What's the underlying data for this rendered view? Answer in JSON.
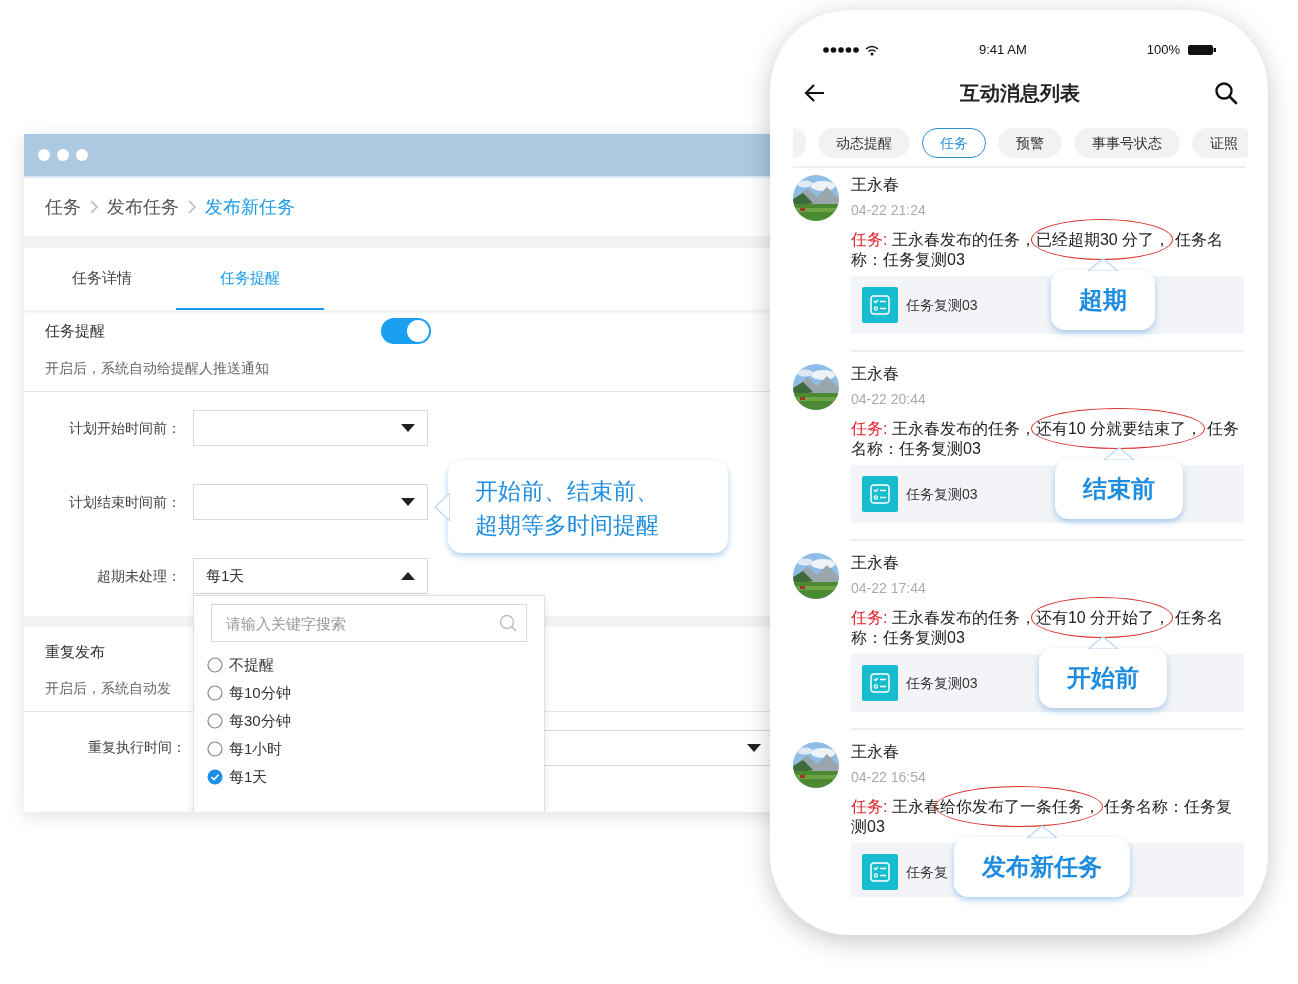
{
  "desktop": {
    "breadcrumb": [
      {
        "label": "任务",
        "current": false
      },
      {
        "label": "发布任务",
        "current": false
      },
      {
        "label": "发布新任务",
        "current": true
      }
    ],
    "tabs": [
      {
        "label": "任务详情",
        "selected": false
      },
      {
        "label": "任务提醒",
        "selected": true
      }
    ],
    "reminder": {
      "label": "任务提醒",
      "on": true,
      "description": "开启后，系统自动给提醒人推送通知",
      "fields": [
        {
          "label": "计划开始时间前：",
          "expanded": false
        },
        {
          "label": "计划结束时间前：",
          "expanded": false
        },
        {
          "label": "超期未处理：",
          "value": "每1天",
          "expanded": true
        }
      ]
    },
    "dropdown": {
      "placeholder": "请输入关键字搜索",
      "options": [
        {
          "label": "不提醒",
          "selected": false
        },
        {
          "label": "每10分钟",
          "selected": false
        },
        {
          "label": "每30分钟",
          "selected": false
        },
        {
          "label": "每1小时",
          "selected": false
        },
        {
          "label": "每1天",
          "selected": true
        }
      ]
    },
    "repeat": {
      "label": "重复发布",
      "description": "开启后，系统自动发",
      "fields": [
        {
          "label": "重复执行时间：",
          "expanded": false
        }
      ]
    },
    "callout": [
      "开始前、结束前、",
      "超期等多时间提醒"
    ]
  },
  "phone": {
    "status_bar": {
      "time": "9:41 AM",
      "battery": "100%"
    },
    "title": "互动消息列表",
    "chips": [
      {
        "label": "动态提醒",
        "selected": false
      },
      {
        "label": "任务",
        "selected": true
      },
      {
        "label": "预警",
        "selected": false
      },
      {
        "label": "事事号状态",
        "selected": false
      },
      {
        "label": "证照",
        "selected": false
      }
    ],
    "messages": [
      {
        "name": "王永春",
        "time": "04-22 21:24",
        "prefix": "任务:",
        "before": "王永春发布的任务，",
        "highlight": "已经超期30 分了，",
        "after": "任务名称：任务复测03",
        "card": "任务复测03",
        "callout": "超期"
      },
      {
        "name": "王永春",
        "time": "04-22 20:44",
        "prefix": "任务:",
        "before": "王永春发布的任务，",
        "highlight": "还有10 分就要结束了，",
        "after": "任务名称：任务复测03",
        "card": "任务复测03",
        "callout": "结束前"
      },
      {
        "name": "王永春",
        "time": "04-22 17:44",
        "prefix": "任务:",
        "before": "王永春发布的任务，",
        "highlight": "还有10 分开始了，",
        "after": "任务名称：任务复测03",
        "card": "任务复测03",
        "callout": "开始前"
      },
      {
        "name": "王永春",
        "time": "04-22 16:54",
        "prefix": "任务:",
        "before": "王永春",
        "highlight": "给你发布了一条任务，",
        "after": "任务名称：任务复测03",
        "card": "任务复",
        "callout": "发布新任务"
      }
    ]
  }
}
